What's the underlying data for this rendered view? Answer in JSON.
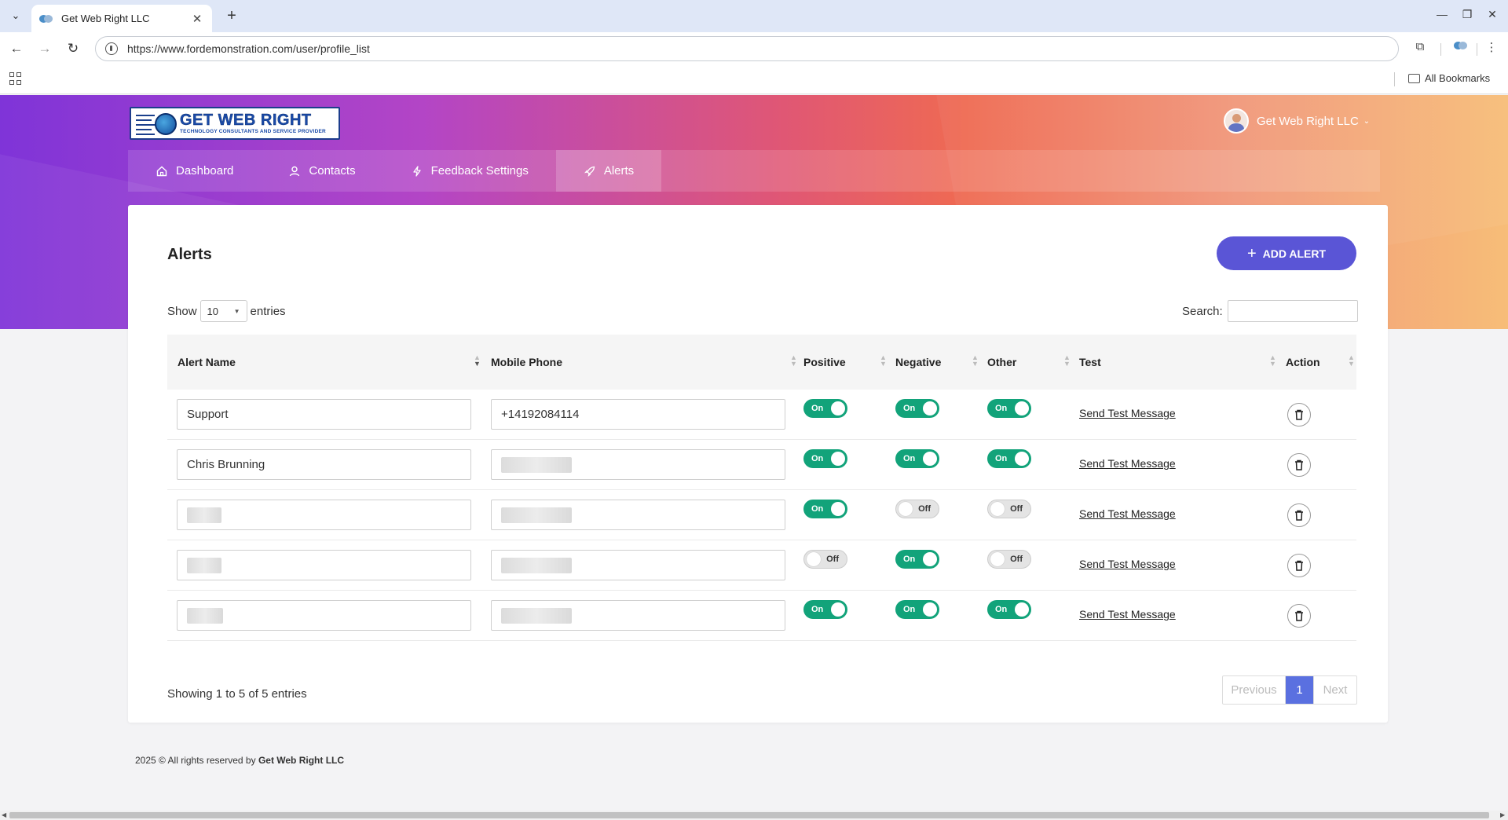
{
  "browser": {
    "tab_title": "Get Web Right LLC",
    "url": "https://www.fordemonstration.com/user/profile_list",
    "all_bookmarks": "All Bookmarks"
  },
  "header": {
    "logo_main": "GET WEB RIGHT",
    "logo_sub": "TECHNOLOGY CONSULTANTS AND SERVICE PROVIDER",
    "user_name": "Get Web Right LLC"
  },
  "nav": {
    "items": [
      {
        "label": "Dashboard",
        "icon": "home-icon"
      },
      {
        "label": "Contacts",
        "icon": "user-icon"
      },
      {
        "label": "Feedback Settings",
        "icon": "bolt-icon"
      },
      {
        "label": "Alerts",
        "icon": "rocket-icon",
        "active": true
      }
    ]
  },
  "card": {
    "title": "Alerts",
    "add_button": "ADD ALERT",
    "show_label": "Show",
    "entries_label": "entries",
    "page_size": "10",
    "search_label": "Search:",
    "search_value": ""
  },
  "table": {
    "columns": [
      "Alert Name",
      "Mobile Phone",
      "Positive",
      "Negative",
      "Other",
      "Test",
      "Action"
    ],
    "test_link_label": "Send Test Message",
    "rows": [
      {
        "name": "Support",
        "phone": "+14192084114",
        "positive": "On",
        "negative": "On",
        "other": "On"
      },
      {
        "name": "Chris Brunning",
        "phone": "",
        "positive": "On",
        "negative": "On",
        "other": "On"
      },
      {
        "name": "",
        "phone": "",
        "positive": "On",
        "negative": "Off",
        "other": "Off"
      },
      {
        "name": "",
        "phone": "",
        "positive": "Off",
        "negative": "On",
        "other": "Off"
      },
      {
        "name": "",
        "phone": "",
        "positive": "On",
        "negative": "On",
        "other": "On"
      }
    ]
  },
  "pagination": {
    "info": "Showing 1 to 5 of 5 entries",
    "previous": "Previous",
    "current": "1",
    "next": "Next"
  },
  "footer": {
    "text": "2025 © All rights reserved by",
    "company": "Get Web Right LLC"
  },
  "colors": {
    "accent": "#5a55d6",
    "toggle_on": "#12a37a",
    "page_active": "#5a70e0"
  }
}
